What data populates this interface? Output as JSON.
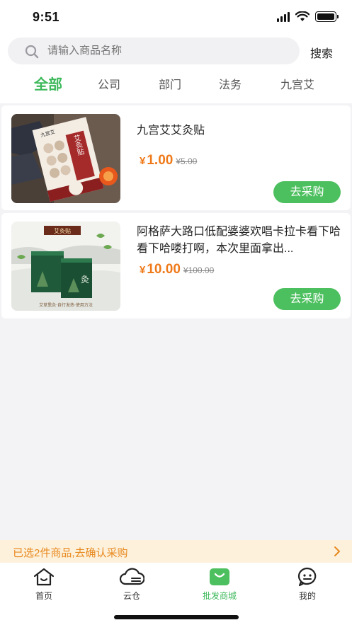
{
  "status_bar": {
    "time": "9:51"
  },
  "search": {
    "placeholder": "请输入商品名称",
    "button_label": "搜索"
  },
  "categories": [
    {
      "label": "全部",
      "active": true
    },
    {
      "label": "公司",
      "active": false
    },
    {
      "label": "部门",
      "active": false
    },
    {
      "label": "法务",
      "active": false
    },
    {
      "label": "九宫艾",
      "active": false
    }
  ],
  "products": [
    {
      "title": "九宫艾艾灸贴",
      "currency": "¥",
      "price": "1.00",
      "original_price": "¥5.00",
      "button_label": "去采购",
      "image_text": {
        "brand": "九宫艾",
        "name": "艾灸贴"
      }
    },
    {
      "title": "阿格萨大路口低配婆婆欢唱卡拉卡看下哈看下哈喽打啊，本次里面拿出...",
      "currency": "¥",
      "price": "10.00",
      "original_price": "¥100.00",
      "button_label": "去采购",
      "image_text": {
        "banner": "艾灸贴",
        "box_mark": "灸",
        "footer": "艾草熏灸·自行发热·使用方法"
      }
    }
  ],
  "selection_bar": {
    "text": "已选2件商品,去确认采购"
  },
  "tab_bar": {
    "items": [
      {
        "label": "首页",
        "icon": "home-icon"
      },
      {
        "label": "云仓",
        "icon": "cloud-warehouse-icon"
      },
      {
        "label": "批发商城",
        "icon": "shopping-bag-icon",
        "active": true
      },
      {
        "label": "我的",
        "icon": "chat-face-icon"
      }
    ]
  },
  "colors": {
    "accent": "#3cb85a",
    "price": "#ef7a1a",
    "banner_bg": "#fdf1dc",
    "banner_text": "#e8891e"
  }
}
